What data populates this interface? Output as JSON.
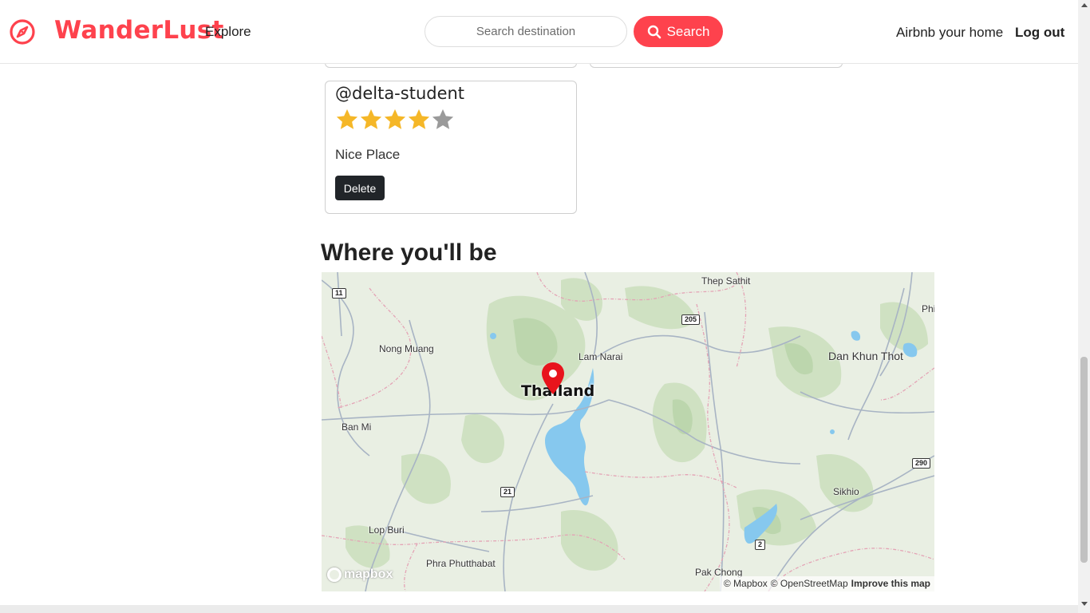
{
  "navbar": {
    "brand": "WanderLust",
    "brand_color": "#fe424d",
    "brand_icon": "compass-icon",
    "explore_label": "Explore",
    "search_placeholder": "Search destination",
    "search_button_label": "Search",
    "search_icon": "search-icon",
    "host_label": "Airbnb your home",
    "logout_label": "Log out"
  },
  "review": {
    "author": "@delta-student",
    "rating": 4,
    "rating_max": 5,
    "comment": "Nice Place",
    "delete_label": "Delete"
  },
  "location": {
    "heading": "Where you'll be",
    "country_label": "Thailand",
    "places": {
      "thep_sathit": "Thep Sathit",
      "nong_muang": "Nong Muang",
      "lam_narai": "Lam Narai",
      "dan_khun_thot": "Dan Khun Thot",
      "ban_mi": "Ban Mi",
      "sikhio": "Sikhio",
      "lop_buri": "Lop Buri",
      "phra_phutthabat": "Phra Phutthabat",
      "pak_chong": "Pak Chong",
      "phi_partial": "Phi"
    },
    "route_shields": [
      "11",
      "205",
      "21",
      "290",
      "2"
    ],
    "mapbox_logo": "mapbox",
    "attribution": {
      "mapbox": "© Mapbox",
      "osm": "© OpenStreetMap",
      "improve": "Improve this map"
    }
  },
  "colors": {
    "accent": "#fe424d",
    "delete_button": "#212529",
    "star_filled": "#f5b728",
    "star_empty": "#9a9a9a"
  }
}
